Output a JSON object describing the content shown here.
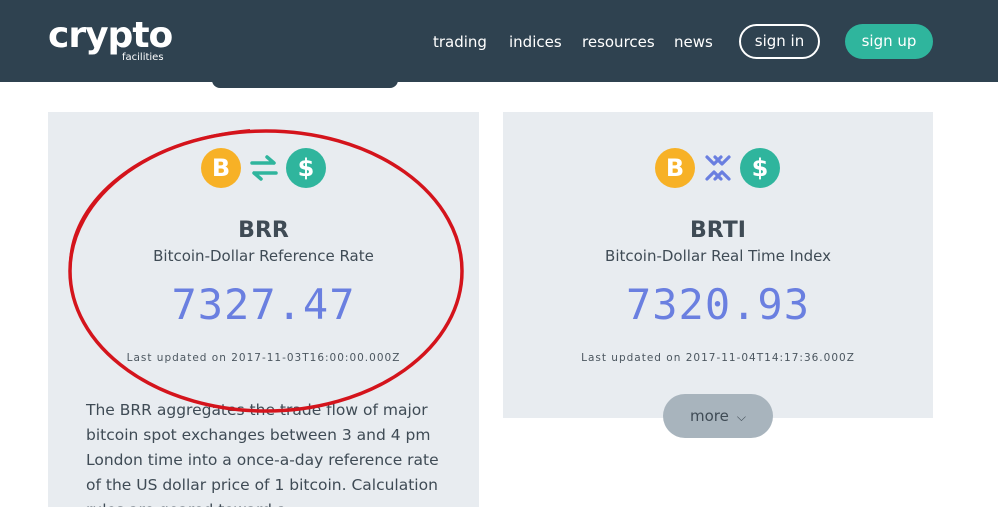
{
  "brand": {
    "logo_main": "crypto",
    "logo_sub": "facilities"
  },
  "nav": {
    "items": [
      {
        "label": "trading"
      },
      {
        "label": "indices"
      },
      {
        "label": "resources"
      },
      {
        "label": "news"
      }
    ],
    "sign_in": "sign in",
    "sign_up": "sign up"
  },
  "colors": {
    "header_bg": "#2f4250",
    "accent_green": "#2fb59d",
    "bitcoin_orange": "#f7b126",
    "value_blue": "#6a7fe0",
    "card_bg": "#e8ecf0",
    "annotation_red": "#d4141c"
  },
  "cards": [
    {
      "icons": [
        "bitcoin-coin-icon",
        "swap-arrows-icon",
        "dollar-coin-icon"
      ],
      "coin_btc": "B",
      "coin_usd": "$",
      "title": "BRR",
      "subtitle": "Bitcoin-Dollar Reference Rate",
      "value": "7327.47",
      "updated": "Last updated on 2017-11-03T16:00:00.000Z",
      "description": "The BRR aggregates the trade flow of major bitcoin spot exchanges between 3 and 4 pm London time into a once-a-day reference rate of the US dollar price of 1 bitcoin. Calculation rules are geared toward a"
    },
    {
      "icons": [
        "bitcoin-coin-icon",
        "realtime-arrows-icon",
        "dollar-coin-icon"
      ],
      "coin_btc": "B",
      "coin_usd": "$",
      "title": "BRTI",
      "subtitle": "Bitcoin-Dollar Real Time Index",
      "value": "7320.93",
      "updated": "Last updated on 2017-11-04T14:17:36.000Z"
    }
  ],
  "more_button": "more"
}
